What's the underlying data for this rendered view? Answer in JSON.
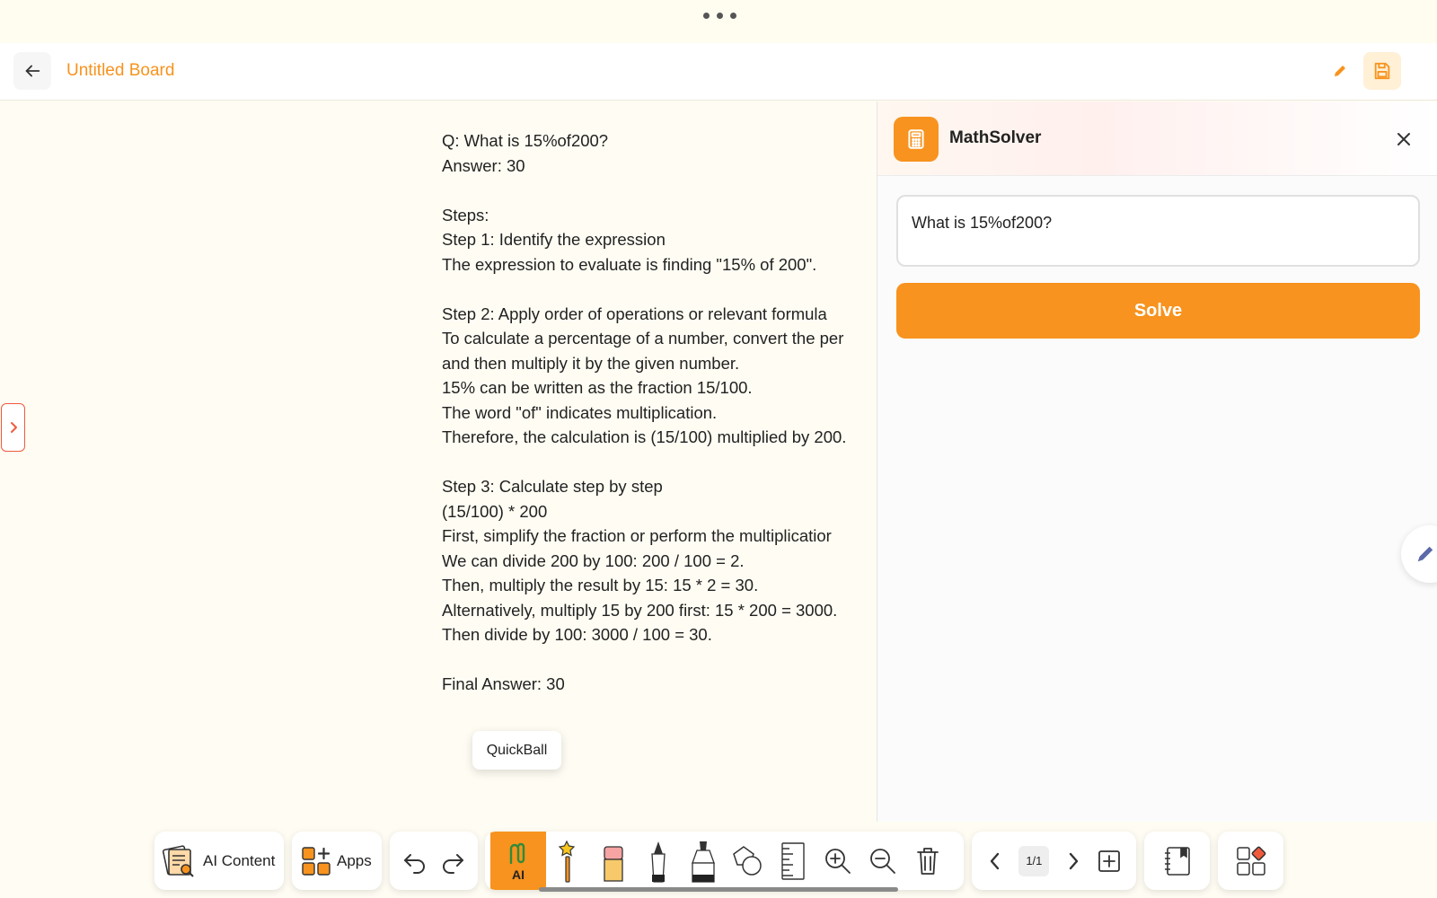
{
  "header": {
    "board_title": "Untitled Board"
  },
  "canvas": {
    "answer_lines": [
      "Q: What is 15%of200?",
      "Answer: 30",
      "",
      "Steps:",
      "Step 1: Identify the expression",
      "The expression to evaluate is finding \"15% of 200\".",
      "",
      "Step 2: Apply order of operations or relevant formula",
      "To calculate a percentage of a number, convert the per",
      "and then multiply it by the given number.",
      "15% can be written as the fraction 15/100.",
      "The word \"of\" indicates multiplication.",
      "Therefore, the calculation is (15/100) multiplied by 200.",
      "",
      "Step 3: Calculate step by step",
      "(15/100) * 200",
      "First, simplify the fraction or perform the multiplicatior",
      "We can divide 200 by 100: 200 / 100 = 2.",
      "Then, multiply the result by 15: 15 * 2 = 30.",
      "Alternatively, multiply 15 by 200 first: 15 * 200 = 3000.",
      "Then divide by 100: 3000 / 100 = 30.",
      "",
      "Final Answer: 30"
    ],
    "quickball_label": "QuickBall"
  },
  "panel": {
    "title": "MathSolver",
    "question_value": "What is 15%of200?",
    "solve_label": "Solve"
  },
  "toolbar": {
    "ai_content_label": "AI Content",
    "apps_label": "Apps",
    "ai_tool_label": "AI",
    "page_indicator": "1/1"
  },
  "colors": {
    "accent": "#f7931e",
    "toggle_border": "#f05a3c",
    "background": "#fffdf3"
  }
}
